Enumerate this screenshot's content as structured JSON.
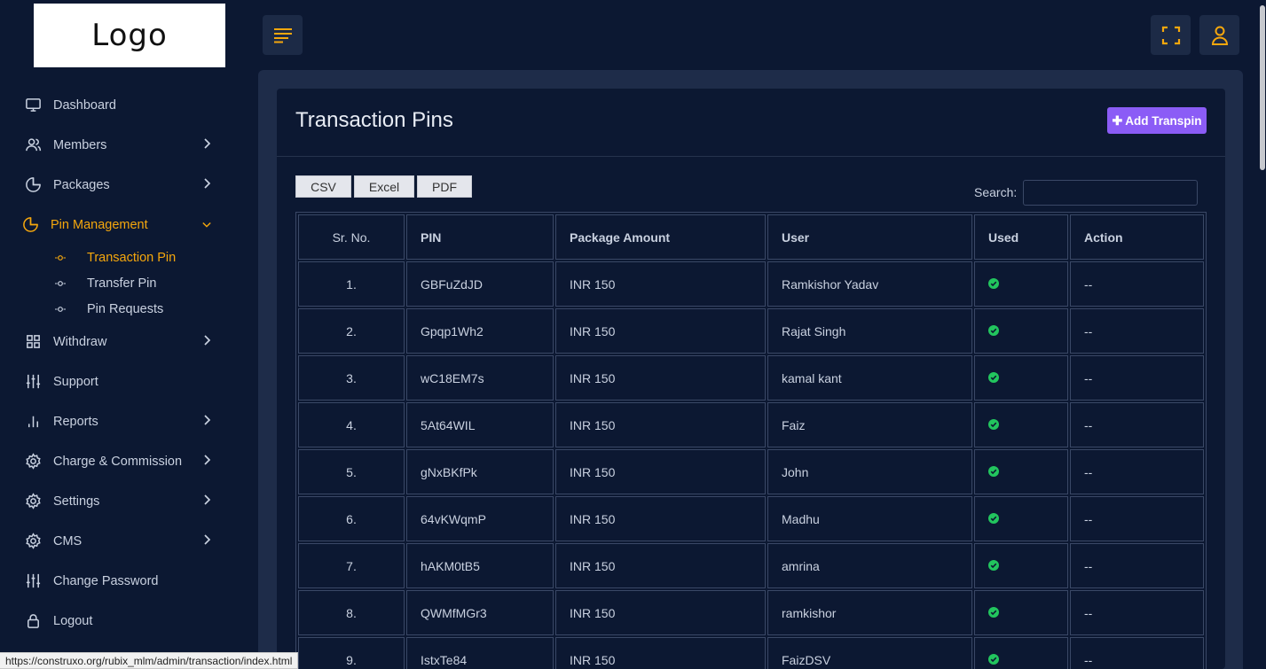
{
  "logo": {
    "text": "Logo"
  },
  "sidebar": {
    "items": [
      {
        "label": "Dashboard",
        "icon": "monitor-icon",
        "chevron": false
      },
      {
        "label": "Members",
        "icon": "users-icon",
        "chevron": true
      },
      {
        "label": "Packages",
        "icon": "pie-chart-icon",
        "chevron": true
      },
      {
        "label": "Pin Management",
        "icon": "pie-chart-icon",
        "chevron": true,
        "active": true,
        "subitems": [
          {
            "label": "Transaction Pin",
            "active": true
          },
          {
            "label": "Transfer Pin"
          },
          {
            "label": "Pin Requests"
          }
        ]
      },
      {
        "label": "Withdraw",
        "icon": "grid-icon",
        "chevron": true
      },
      {
        "label": "Support",
        "icon": "sliders-icon",
        "chevron": false
      },
      {
        "label": "Reports",
        "icon": "bar-chart-icon",
        "chevron": true
      },
      {
        "label": "Charge & Commission",
        "icon": "gear-icon",
        "chevron": true
      },
      {
        "label": "Settings",
        "icon": "gear-icon",
        "chevron": true
      },
      {
        "label": "CMS",
        "icon": "gear-icon",
        "chevron": true
      },
      {
        "label": "Change Password",
        "icon": "sliders-icon",
        "chevron": false
      },
      {
        "label": "Logout",
        "icon": "lock-icon",
        "chevron": false
      }
    ]
  },
  "colors": {
    "background": "#0c1832",
    "accent": "#f5a70d",
    "button_primary": "#8b5cf6",
    "check_green": "#22c55e"
  },
  "page": {
    "title": "Transaction Pins",
    "add_button": "Add Transpin",
    "export_buttons": [
      "CSV",
      "Excel",
      "PDF"
    ],
    "search_label": "Search:",
    "search_value": ""
  },
  "table": {
    "headers": [
      "Sr. No.",
      "PIN",
      "Package Amount",
      "User",
      "Used",
      "Action"
    ],
    "rows": [
      {
        "sr": "1.",
        "pin": "GBFuZdJD",
        "amount": "INR 150",
        "user": "Ramkishor Yadav",
        "used": true,
        "action": "--"
      },
      {
        "sr": "2.",
        "pin": "Gpqp1Wh2",
        "amount": "INR 150",
        "user": "Rajat Singh",
        "used": true,
        "action": "--"
      },
      {
        "sr": "3.",
        "pin": "wC18EM7s",
        "amount": "INR 150",
        "user": "kamal kant",
        "used": true,
        "action": "--"
      },
      {
        "sr": "4.",
        "pin": "5At64WIL",
        "amount": "INR 150",
        "user": "Faiz",
        "used": true,
        "action": "--"
      },
      {
        "sr": "5.",
        "pin": "gNxBKfPk",
        "amount": "INR 150",
        "user": "John",
        "used": true,
        "action": "--"
      },
      {
        "sr": "6.",
        "pin": "64vKWqmP",
        "amount": "INR 150",
        "user": "Madhu",
        "used": true,
        "action": "--"
      },
      {
        "sr": "7.",
        "pin": "hAKM0tB5",
        "amount": "INR 150",
        "user": "amrina",
        "used": true,
        "action": "--"
      },
      {
        "sr": "8.",
        "pin": "QWMfMGr3",
        "amount": "INR 150",
        "user": "ramkishor",
        "used": true,
        "action": "--"
      },
      {
        "sr": "9.",
        "pin": "IstxTe84",
        "amount": "INR 150",
        "user": "FaizDSV",
        "used": true,
        "action": "--"
      }
    ]
  },
  "statusbar": {
    "url": "https://construxo.org/rubix_mlm/admin/transaction/index.html"
  }
}
